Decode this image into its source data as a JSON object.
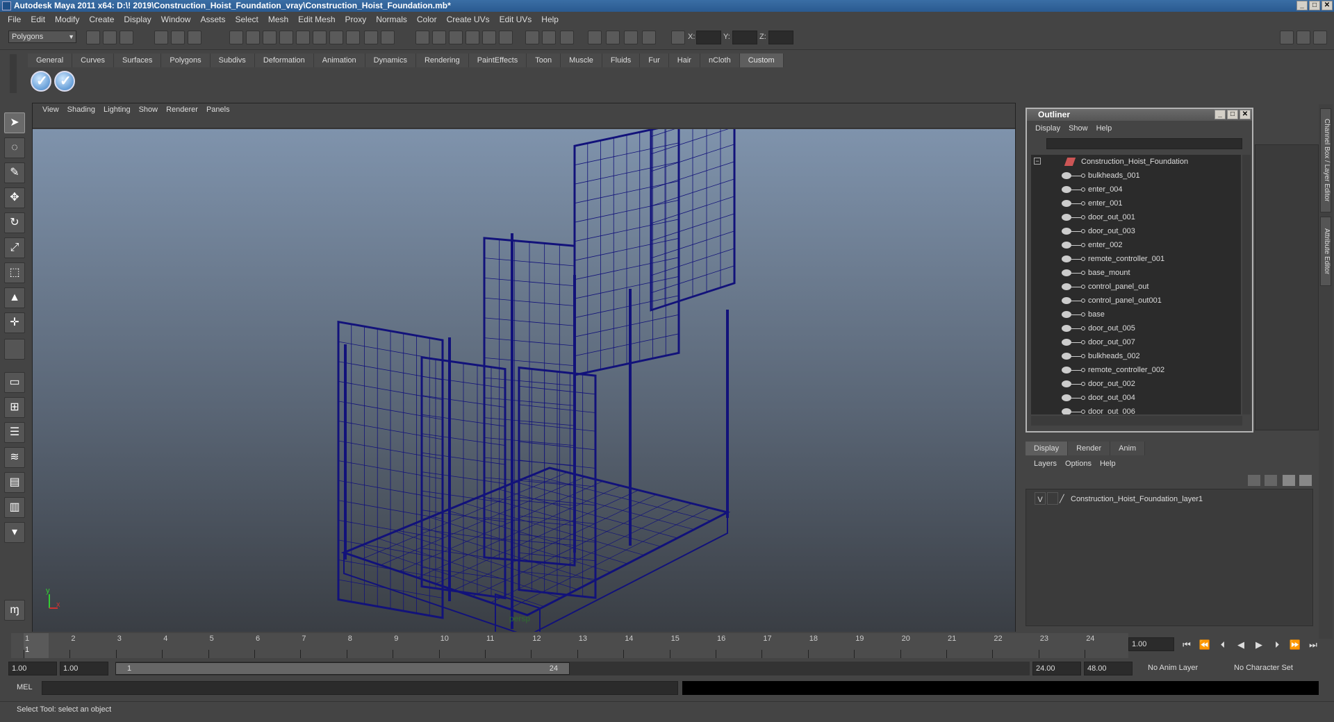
{
  "window": {
    "title": "Autodesk Maya 2011 x64: D:\\! 2019\\Construction_Hoist_Foundation_vray\\Construction_Hoist_Foundation.mb*"
  },
  "menubar": [
    "File",
    "Edit",
    "Modify",
    "Create",
    "Display",
    "Window",
    "Assets",
    "Select",
    "Mesh",
    "Edit Mesh",
    "Proxy",
    "Normals",
    "Color",
    "Create UVs",
    "Edit UVs",
    "Help"
  ],
  "statusline": {
    "mode": "Polygons",
    "x_label": "X:",
    "y_label": "Y:",
    "z_label": "Z:"
  },
  "shelf": {
    "tabs": [
      "General",
      "Curves",
      "Surfaces",
      "Polygons",
      "Subdivs",
      "Deformation",
      "Animation",
      "Dynamics",
      "Rendering",
      "PaintEffects",
      "Toon",
      "Muscle",
      "Fluids",
      "Fur",
      "Hair",
      "nCloth",
      "Custom"
    ],
    "active": "Custom"
  },
  "viewport": {
    "menu": [
      "View",
      "Shading",
      "Lighting",
      "Show",
      "Renderer",
      "Panels"
    ],
    "camera": "persp",
    "axis_x": "x",
    "axis_y": "y",
    "wire_color": "#12127a"
  },
  "outliner": {
    "title": "Outliner",
    "menu": [
      "Display",
      "Show",
      "Help"
    ],
    "root": "Construction_Hoist_Foundation",
    "items": [
      "bulkheads_001",
      "enter_004",
      "enter_001",
      "door_out_001",
      "door_out_003",
      "enter_002",
      "remote_controller_001",
      "base_mount",
      "control_panel_out",
      "control_panel_out001",
      "base",
      "door_out_005",
      "door_out_007",
      "bulkheads_002",
      "remote_controller_002",
      "door_out_002",
      "door_out_004",
      "door_out_006"
    ]
  },
  "right_tabs": [
    "Channel Box / Layer Editor",
    "Attribute Editor"
  ],
  "layer_editor": {
    "tabs": [
      "Display",
      "Render",
      "Anim"
    ],
    "active": "Display",
    "menu": [
      "Layers",
      "Options",
      "Help"
    ],
    "layer": {
      "visible": "V",
      "name": "Construction_Hoist_Foundation_layer1"
    }
  },
  "timeline": {
    "ticks": [
      "1",
      "2",
      "3",
      "4",
      "5",
      "6",
      "7",
      "8",
      "9",
      "10",
      "11",
      "12",
      "13",
      "14",
      "15",
      "16",
      "17",
      "18",
      "19",
      "20",
      "21",
      "22",
      "23",
      "24"
    ],
    "current_marker": "1",
    "current_frame": "1.00"
  },
  "range": {
    "start": "1.00",
    "playback_start": "1.00",
    "slider_start": "1",
    "slider_end": "24",
    "playback_end": "24.00",
    "end": "48.00",
    "anim_layer": "No Anim Layer",
    "character_set": "No Character Set"
  },
  "command": {
    "label": "MEL"
  },
  "help_line": "Select Tool: select an object"
}
